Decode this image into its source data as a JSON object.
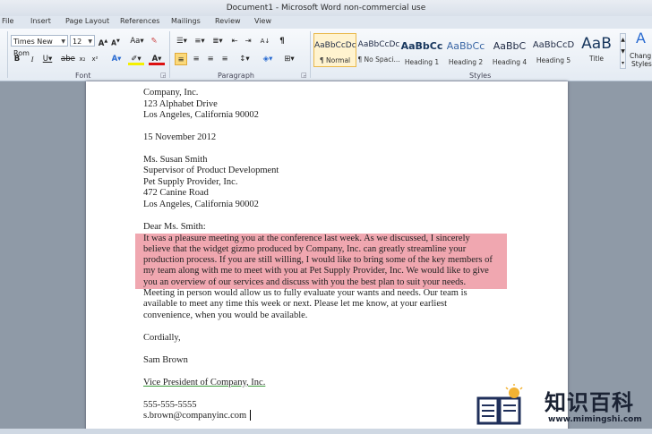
{
  "window": {
    "title": "Document1 - Microsoft Word non-commercial use"
  },
  "tabs": [
    "File",
    "Insert",
    "Page Layout",
    "References",
    "Mailings",
    "Review",
    "View"
  ],
  "font": {
    "name": "Times New Rom",
    "size": "12",
    "group_label": "Font"
  },
  "paragraph": {
    "group_label": "Paragraph"
  },
  "styles": {
    "group_label": "Styles",
    "items": [
      {
        "sample": "AaBbCcDc",
        "name": "¶ Normal"
      },
      {
        "sample": "AaBbCcDc",
        "name": "¶ No Spaci..."
      },
      {
        "sample": "AaBbCc",
        "name": "Heading 1"
      },
      {
        "sample": "AaBbCc",
        "name": "Heading 2"
      },
      {
        "sample": "AaBbC",
        "name": "Heading 4"
      },
      {
        "sample": "AaBbCcD",
        "name": "Heading 5"
      },
      {
        "sample": "AaB",
        "name": "Title"
      }
    ],
    "change_label_1": "Chang",
    "change_label_2": "Styles"
  },
  "document": {
    "lines": [
      "Company, Inc.",
      "123 Alphabet Drive",
      "Los Angeles, California 90002",
      "",
      "15 November 2012",
      "",
      "Ms. Susan Smith",
      "Supervisor of Product Development",
      "Pet Supply Provider, Inc.",
      "472 Canine Road",
      "Los Angeles, California 90002",
      "",
      "Dear Ms. Smith:",
      "It was a pleasure meeting you at the conference last week. As we discussed, I sincerely",
      "believe that the widget gizmo produced by Company, Inc. can greatly streamline  your",
      "production process.  If you are still willing, I would like to bring some of the key members  of",
      "my team along with me to meet with you at Pet Supply Provider, Inc. We would like to give",
      "you an overview of our services  and discuss with you the best plan to suit your needs.",
      "Meeting in person would allow us to fully evaluate your wants and needs. Our team is",
      "available to meet any time this week or next. Please let me know, at your earliest",
      "convenience, when you would be available.",
      "",
      "Cordially,",
      "",
      "Sam Brown",
      "",
      "Vice President of Company, Inc.",
      "",
      "555-555-5555",
      "s.brown@companyinc.com"
    ]
  },
  "watermark": {
    "title": "知识百科",
    "url": "www.mimingshi.com"
  }
}
